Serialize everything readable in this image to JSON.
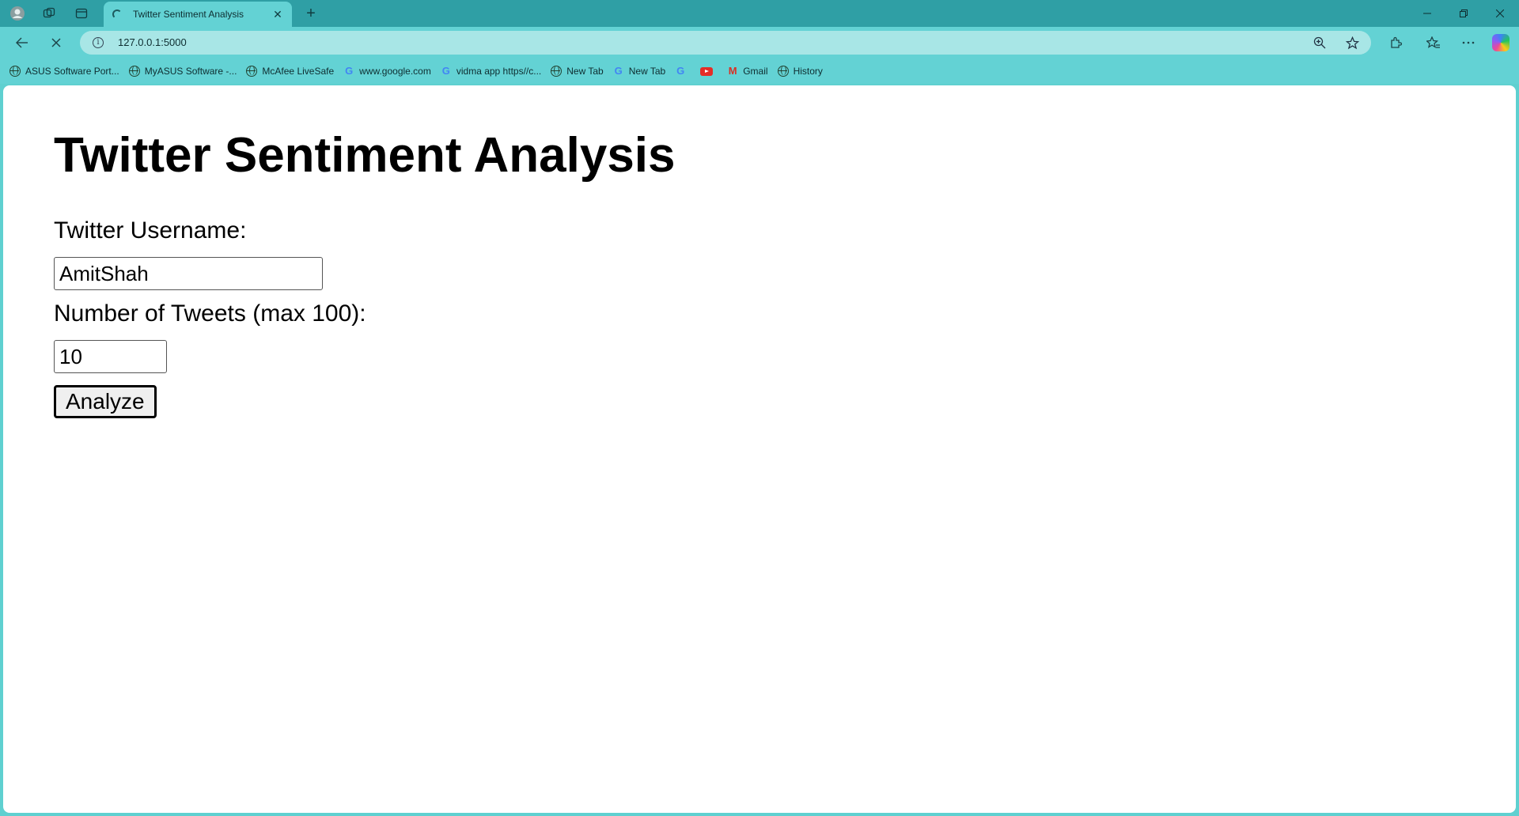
{
  "browser": {
    "tab": {
      "title": "Twitter Sentiment Analysis"
    },
    "address_bar": {
      "url": "127.0.0.1:5000"
    },
    "bookmarks": [
      {
        "label": "ASUS Software Port...",
        "icon": "globe-icon"
      },
      {
        "label": "MyASUS Software -...",
        "icon": "globe-icon"
      },
      {
        "label": "McAfee LiveSafe",
        "icon": "globe-icon"
      },
      {
        "label": "www.google.com",
        "icon": "google-icon"
      },
      {
        "label": "vidma app https//c...",
        "icon": "google-icon"
      },
      {
        "label": "New Tab",
        "icon": "globe-icon"
      },
      {
        "label": "New Tab",
        "icon": "google-icon"
      },
      {
        "label": "",
        "icon": "google-icon"
      },
      {
        "label": "",
        "icon": "youtube-icon"
      },
      {
        "label": "Gmail",
        "icon": "gmail-icon"
      },
      {
        "label": "History",
        "icon": "globe-icon"
      }
    ],
    "colors": {
      "titlebar": "#2f9fa5",
      "toolbar": "#63d2d4",
      "omnibox": "#a8e6e6"
    }
  },
  "page": {
    "title": "Twitter Sentiment Analysis",
    "form": {
      "username_label": "Twitter Username:",
      "username_value": "AmitShah",
      "count_label": "Number of Tweets (max 100):",
      "count_value": "10",
      "submit_label": "Analyze"
    }
  }
}
